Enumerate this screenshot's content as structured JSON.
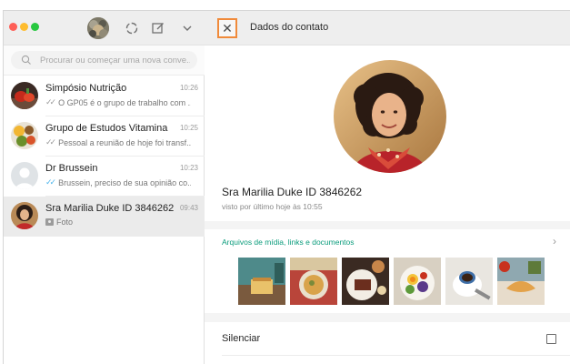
{
  "search": {
    "placeholder": "Procurar ou começar uma nova conve..."
  },
  "chats": [
    {
      "name": "Simpósio Nutrição",
      "time": "10:26",
      "message": "O GP05 é o grupo de trabalho com ...",
      "ticks": "read-grey"
    },
    {
      "name": "Grupo de Estudos Vitamina",
      "time": "10:25",
      "message": "Pessoal a reunião de hoje foi transf...",
      "ticks": "read-grey"
    },
    {
      "name": "Dr Brussein",
      "time": "10:23",
      "message": "Brussein, preciso de sua opinião co...",
      "ticks": "read-blue"
    },
    {
      "name": "Sra Marilia Duke ID 3846262",
      "time": "09:43",
      "message": "Foto",
      "ticks": "photo",
      "selected": true
    }
  ],
  "header_icons": [
    "status-icon",
    "new-chat-icon",
    "chevron-down-icon"
  ],
  "contact_panel": {
    "title": "Dados do contato",
    "name": "Sra Marilia Duke ID 3846262",
    "last_seen": "visto por último hoje às 10:55",
    "media_title": "Arquivos de mídia, links e documentos",
    "mute_label": "Silenciar",
    "mute_checked": false
  },
  "colors": {
    "accent_green": "#0b9c7c",
    "read_blue": "#4fb6ec",
    "highlight_orange": "#f08a3a"
  }
}
